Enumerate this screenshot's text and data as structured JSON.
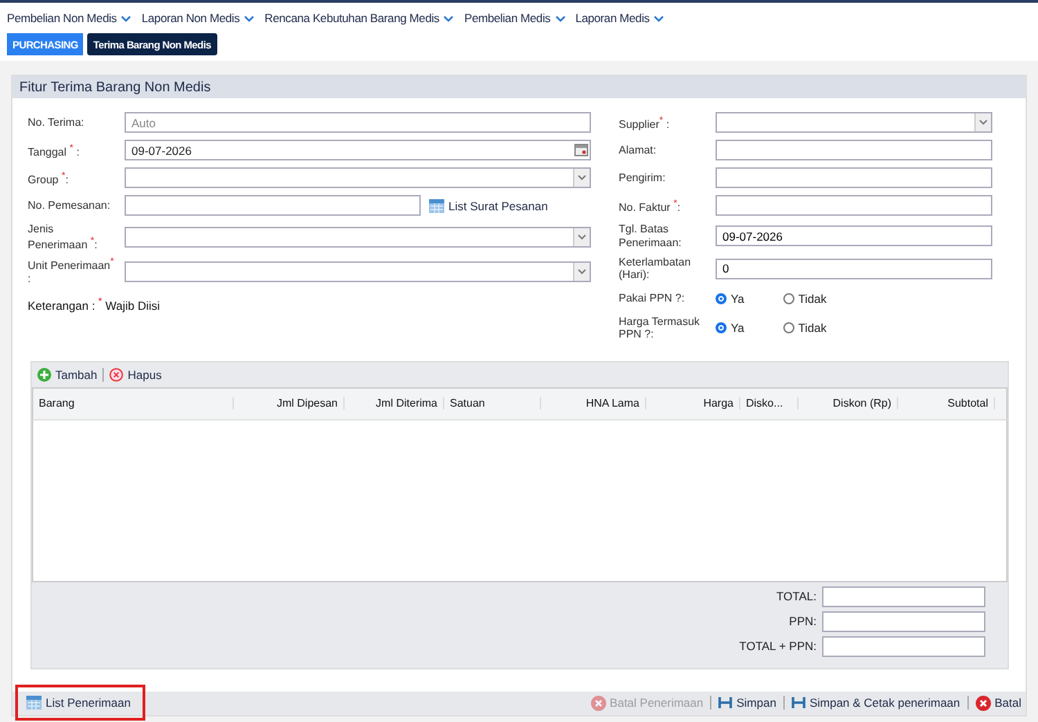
{
  "menu": [
    {
      "label": "Pembelian Non Medis"
    },
    {
      "label": "Laporan Non Medis"
    },
    {
      "label": "Rencana Kebutuhan Barang Medis"
    },
    {
      "label": "Pembelian Medis"
    },
    {
      "label": "Laporan Medis"
    }
  ],
  "breadcrumbs": [
    {
      "label": "PURCHASING",
      "kind": "module"
    },
    {
      "label": "Terima Barang Non Medis",
      "kind": "page"
    }
  ],
  "panel": {
    "title": "Fitur Terima Barang Non Medis"
  },
  "left_fields": [
    {
      "label": "No. Terima:",
      "kind": "text",
      "placeholder": "Auto"
    },
    {
      "label": "Tanggal $^{*}$ :",
      "kind": "date",
      "value": "09-07-2026"
    },
    {
      "label": "Group $^{*}$:",
      "kind": "select"
    },
    {
      "label": "No. Pemesanan:",
      "kind": "lookup",
      "link": "List Surat Pesanan"
    },
    {
      "label": "Jenis Penerimaan $^{*}$:",
      "kind": "select"
    },
    {
      "label": "Unit Penerimaan$^{*}$ :",
      "kind": "select"
    }
  ],
  "note": "Keterangan : $^{*}$ Wajib Diisi",
  "right_fields": [
    {
      "label": "Supplier$^{*}$ :",
      "kind": "select"
    },
    {
      "label": "Alamat:",
      "kind": "text"
    },
    {
      "label": "Pengirim:",
      "kind": "text"
    },
    {
      "label": "No. Faktur $^{*}$:",
      "kind": "text"
    },
    {
      "label": "Tgl. Batas Penerimaan:",
      "kind": "text",
      "value": "09-07-2026"
    },
    {
      "label": "Keterlambatan (Hari):",
      "kind": "text",
      "value": "0"
    },
    {
      "label": "Pakai PPN ?:",
      "kind": "radio",
      "options": [
        {
          "label": "Ya",
          "selected": true
        },
        {
          "label": "Tidak",
          "selected": false
        }
      ]
    },
    {
      "label": "Harga Termasuk PPN ?:",
      "kind": "radio",
      "options": [
        {
          "label": "Ya",
          "selected": true
        },
        {
          "label": "Tidak",
          "selected": false
        }
      ]
    }
  ],
  "grid_toolbar": [
    {
      "label": "Tambah",
      "kind": "add"
    },
    {
      "label": "Hapus",
      "kind": "remove"
    }
  ],
  "table": {
    "columns": [
      {
        "label": "Barang"
      },
      {
        "label": "Jml Dipesan"
      },
      {
        "label": "Jml Diterima"
      },
      {
        "label": "Satuan"
      },
      {
        "label": "HNA Lama"
      },
      {
        "label": "Harga"
      },
      {
        "label": "Disko..."
      },
      {
        "label": "Diskon (Rp)"
      },
      {
        "label": "Subtotal"
      }
    ]
  },
  "totals": [
    {
      "label": "TOTAL:"
    },
    {
      "label": "PPN:"
    },
    {
      "label": "TOTAL + PPN:"
    }
  ],
  "footer": {
    "list_button": {
      "label": "List Penerimaan",
      "highlighted": true
    },
    "actions": [
      {
        "label": "Batal Penerimaan",
        "kind": "cancel",
        "disabled": true
      },
      {
        "label": "Simpan",
        "kind": "save",
        "disabled": false
      },
      {
        "label": "Simpan & Cetak penerimaan",
        "kind": "save",
        "disabled": false
      },
      {
        "label": "Batal",
        "kind": "cancel",
        "disabled": false
      }
    ]
  }
}
